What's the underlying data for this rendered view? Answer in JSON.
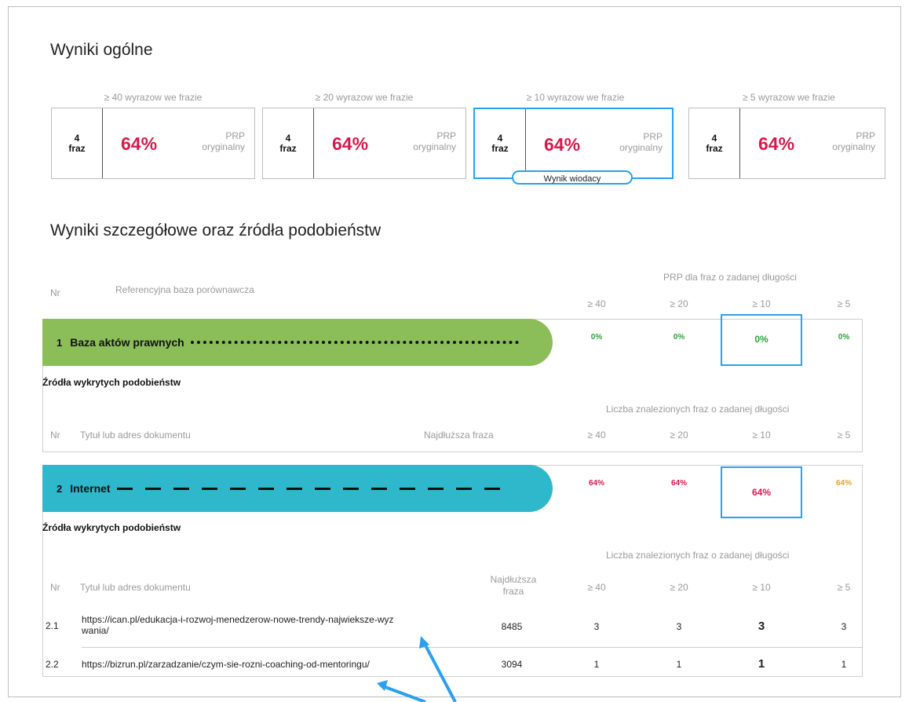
{
  "colors": {
    "accent": "#2aa0ee",
    "percent_red": "#d51a4c",
    "green_band": "#8bbd58",
    "cyan_band": "#2fb7cc",
    "zero_green": "#2aa33a",
    "orange": "#f0a020"
  },
  "section_general": {
    "title": "Wyniki ogólne"
  },
  "cards": [
    {
      "label": "≥ 40 wyrazow we frazie",
      "count": "4",
      "count_unit": "fraz",
      "percent": "64%",
      "prp": "PRP",
      "prp_sub": "oryginalny"
    },
    {
      "label": "≥ 20 wyrazow we frazie",
      "count": "4",
      "count_unit": "fraz",
      "percent": "64%",
      "prp": "PRP",
      "prp_sub": "oryginalny"
    },
    {
      "label": "≥ 10 wyrazow we frazie",
      "count": "4",
      "count_unit": "fraz",
      "percent": "64%",
      "prp": "PRP",
      "prp_sub": "oryginalny",
      "badge": "Wynik wiodacy"
    },
    {
      "label": "≥ 5 wyrazow we frazie",
      "count": "4",
      "count_unit": "fraz",
      "percent": "64%",
      "prp": "PRP",
      "prp_sub": "oryginalny"
    }
  ],
  "section_detail": {
    "title": "Wyniki szczegółowe oraz źródła podobieństw"
  },
  "header": {
    "nr": "Nr",
    "base": "Referencyjna baza porównawcza",
    "prp_group": "PRP dla fraz o zadanej długości",
    "cols": [
      "≥ 40",
      "≥ 20",
      "≥ 10",
      "≥ 5"
    ]
  },
  "bases": [
    {
      "nr": "1",
      "name": "Baza aktów prawnych",
      "values": [
        "0%",
        "0%",
        "0%",
        "0%"
      ]
    },
    {
      "nr": "2",
      "name": "Internet",
      "values": [
        "64%",
        "64%",
        "64%",
        "64%"
      ]
    }
  ],
  "sources_label": "Źródła wykrytych podobieństw",
  "count_group": "Liczba znalezionych fraz o zadanej długości",
  "src_header": {
    "nr": "Nr",
    "title": "Tytuł lub adres dokumentu",
    "longest": "Najdłuższa fraza",
    "longest_line1": "Najdłuższa",
    "longest_line2": "fraza"
  },
  "sources": [
    {
      "nr": "2.1",
      "title_line1": "https://ican.pl/edukacja-i-rozwoj-menedzerow-nowe-trendy-najwieksze-wyz",
      "title_line2": "wania/",
      "longest": "8485",
      "counts": [
        "3",
        "3",
        "3",
        "3"
      ]
    },
    {
      "nr": "2.2",
      "title_line1": "https://bizrun.pl/zarzadzanie/czym-sie-rozni-coaching-od-mentoringu/",
      "title_line2": "",
      "longest": "3094",
      "counts": [
        "1",
        "1",
        "1",
        "1"
      ]
    }
  ]
}
